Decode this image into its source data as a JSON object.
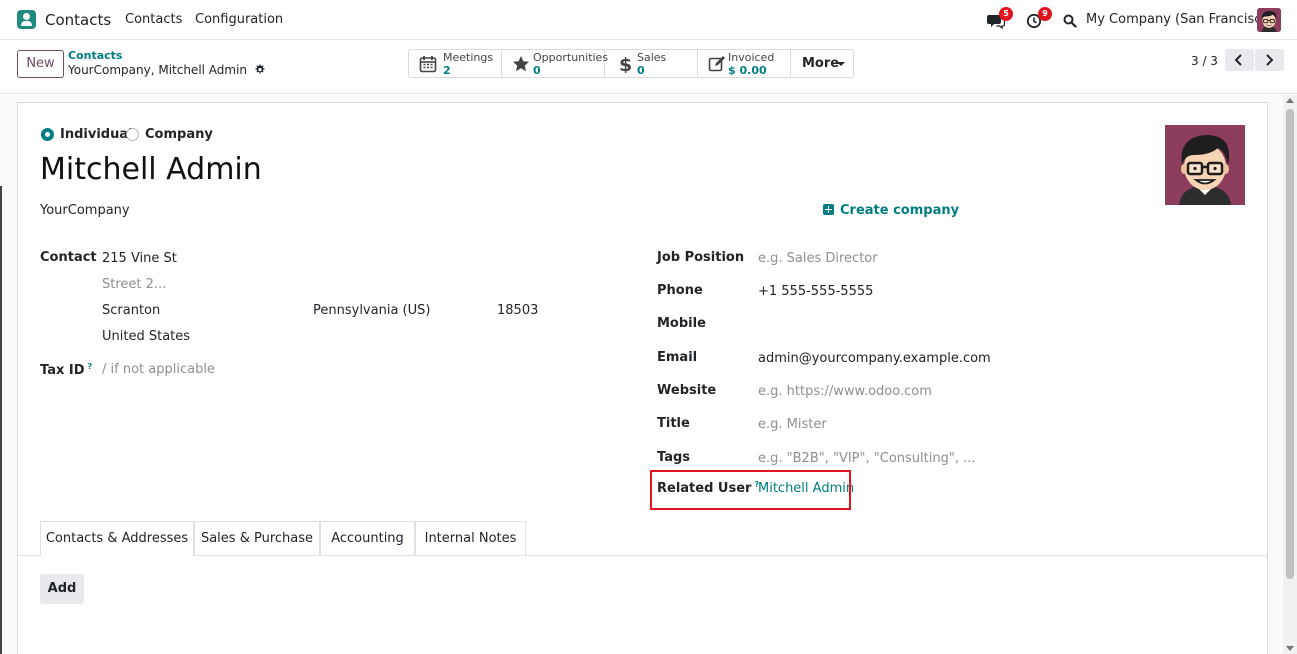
{
  "navbar": {
    "app_name": "Contacts",
    "menu": [
      "Contacts",
      "Configuration"
    ],
    "messages_count": "5",
    "activities_count": "9",
    "company": "My Company (San Francisco)"
  },
  "control_panel": {
    "new_label": "New",
    "breadcrumb_parent": "Contacts",
    "breadcrumb_current": "YourCompany, Mitchell Admin",
    "smart_buttons": [
      {
        "label": "Meetings",
        "value": "2",
        "icon": "calendar-icon"
      },
      {
        "label": "Opportunities",
        "value": "0",
        "icon": "star-icon"
      },
      {
        "label": "Sales",
        "value": "0",
        "icon": "dollar-icon"
      },
      {
        "label": "Invoiced",
        "value": "$ 0.00",
        "icon": "edit-icon"
      }
    ],
    "more_label": "More",
    "pager": "3 / 3"
  },
  "form": {
    "type_individual": "Individual",
    "type_company": "Company",
    "name": "Mitchell Admin",
    "parent_company": "YourCompany",
    "create_company": "Create company",
    "contact_label": "Contact",
    "street": "215 Vine St",
    "street2_placeholder": "Street 2...",
    "city": "Scranton",
    "state": "Pennsylvania (US)",
    "zip": "18503",
    "country": "United States",
    "tax_id_label": "Tax ID",
    "tax_id_placeholder": "/ if not applicable",
    "job_position_label": "Job Position",
    "job_position_placeholder": "e.g. Sales Director",
    "phone_label": "Phone",
    "phone": "+1 555-555-5555",
    "mobile_label": "Mobile",
    "email_label": "Email",
    "email": "admin@yourcompany.example.com",
    "website_label": "Website",
    "website_placeholder": "e.g. https://www.odoo.com",
    "title_label": "Title",
    "title_placeholder": "e.g. Mister",
    "tags_label": "Tags",
    "tags_placeholder": "e.g. \"B2B\", \"VIP\", \"Consulting\", ...",
    "related_user_label": "Related User",
    "related_user": "Mitchell Admin",
    "help_mark": "?"
  },
  "notebook": {
    "tabs": [
      "Contacts & Addresses",
      "Sales & Purchase",
      "Accounting",
      "Internal Notes"
    ],
    "add_label": "Add"
  },
  "colors": {
    "accent": "#017e84",
    "brand": "#714b67",
    "highlight": "#e0141e"
  }
}
